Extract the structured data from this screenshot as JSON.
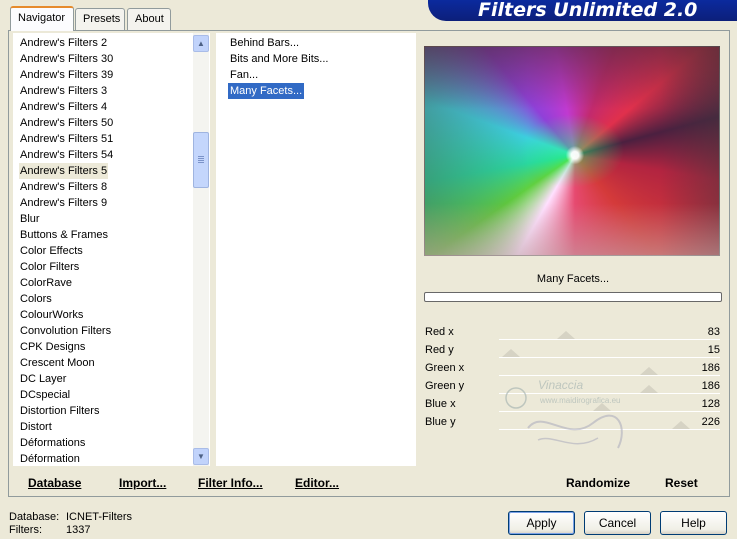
{
  "tabs": [
    {
      "label": "Navigator",
      "active": true
    },
    {
      "label": "Presets",
      "active": false
    },
    {
      "label": "About",
      "active": false
    }
  ],
  "banner_title": "Filters Unlimited 2.0",
  "categories": [
    "Andrew's Filters 2",
    "Andrew's Filters 30",
    "Andrew's Filters 39",
    "Andrew's Filters 3",
    "Andrew's Filters 4",
    "Andrew's Filters 50",
    "Andrew's Filters 51",
    "Andrew's Filters 54",
    "Andrew's Filters 5",
    "Andrew's Filters 8",
    "Andrew's Filters 9",
    "Blur",
    "Buttons & Frames",
    "Color Effects",
    "Color Filters",
    "ColorRave",
    "Colors",
    "ColourWorks",
    "Convolution Filters",
    "CPK Designs",
    "Crescent Moon",
    "DC Layer",
    "DCspecial",
    "Distortion Filters",
    "Distort",
    "Déformations",
    "Déformation"
  ],
  "selected_category": "Andrew's Filters 5",
  "filters": [
    "Behind Bars...",
    "Bits and More Bits...",
    "Fan...",
    "Many Facets..."
  ],
  "selected_filter": "Many Facets...",
  "filter_title": "Many Facets...",
  "params": [
    {
      "name": "Red x",
      "value": "83"
    },
    {
      "name": "Red y",
      "value": "15"
    },
    {
      "name": "Green x",
      "value": "186"
    },
    {
      "name": "Green y",
      "value": "186"
    },
    {
      "name": "Blue x",
      "value": "128"
    },
    {
      "name": "Blue y",
      "value": "226"
    }
  ],
  "param_max": 255,
  "bottom_links": {
    "database": "Database",
    "import": "Import...",
    "filter_info": "Filter Info...",
    "editor": "Editor...",
    "randomize": "Randomize",
    "reset": "Reset"
  },
  "footer": {
    "database_label": "Database:",
    "database_value": "ICNET-Filters",
    "filters_label": "Filters:",
    "filters_value": "1337"
  },
  "buttons": {
    "apply": "Apply",
    "cancel": "Cancel",
    "help": "Help"
  },
  "watermark": {
    "name": "Vinaccia",
    "url": "www.maidirografica.eu"
  },
  "icons": {
    "scroll_up": "chevron-up-icon",
    "scroll_down": "chevron-down-icon"
  },
  "colors": {
    "selection": "#316ac5",
    "tab_accent": "#e68b2c",
    "banner": "#0b2a9e",
    "dialog_bg": "#ece9d8"
  }
}
